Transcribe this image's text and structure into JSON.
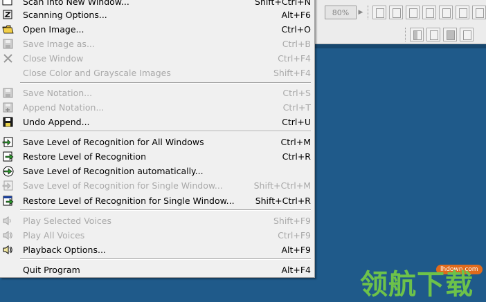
{
  "toolbar": {
    "zoom_value": "80%"
  },
  "menu": {
    "items": [
      {
        "label": "Scan Into New Window...",
        "shortcut": "Shift+Ctrl+N",
        "enabled": true,
        "icon": "scan-new-window-icon"
      },
      {
        "label": "Scanning Options...",
        "shortcut": "Alt+F6",
        "enabled": true,
        "icon": "scanning-options-icon"
      },
      {
        "label": "Open Image...",
        "shortcut": "Ctrl+O",
        "enabled": true,
        "icon": "open-folder-icon"
      },
      {
        "label": "Save Image as...",
        "shortcut": "Ctrl+B",
        "enabled": false,
        "icon": "save-disk-icon"
      },
      {
        "label": "Close Window",
        "shortcut": "Ctrl+F4",
        "enabled": false,
        "icon": "close-x-icon"
      },
      {
        "label": "Close Color and Grayscale Images",
        "shortcut": "Shift+F4",
        "enabled": false,
        "icon": ""
      },
      {
        "label": "Save Notation...",
        "shortcut": "Ctrl+S",
        "enabled": false,
        "icon": "save-notation-icon"
      },
      {
        "label": "Append Notation...",
        "shortcut": "Ctrl+T",
        "enabled": false,
        "icon": "append-notation-icon"
      },
      {
        "label": "Undo Append...",
        "shortcut": "Ctrl+U",
        "enabled": true,
        "icon": "undo-append-icon"
      },
      {
        "label": "Save Level of Recognition for All Windows",
        "shortcut": "Ctrl+M",
        "enabled": true,
        "icon": "save-level-all-icon"
      },
      {
        "label": "Restore Level of Recognition",
        "shortcut": "Ctrl+R",
        "enabled": true,
        "icon": "restore-level-icon"
      },
      {
        "label": "Save Level of Recognition automatically...",
        "shortcut": "",
        "enabled": true,
        "icon": "save-level-auto-icon"
      },
      {
        "label": "Save Level of Recognition for Single Window...",
        "shortcut": "Shift+Ctrl+M",
        "enabled": false,
        "icon": "save-level-single-icon"
      },
      {
        "label": "Restore Level of Recognition for Single Window...",
        "shortcut": "Shift+Ctrl+R",
        "enabled": true,
        "icon": "restore-level-single-icon"
      },
      {
        "label": "Play Selected Voices",
        "shortcut": "Shift+F9",
        "enabled": false,
        "icon": "speaker-icon"
      },
      {
        "label": "Play All Voices",
        "shortcut": "Ctrl+F9",
        "enabled": false,
        "icon": "speaker-all-icon"
      },
      {
        "label": "Playback Options...",
        "shortcut": "Alt+F9",
        "enabled": true,
        "icon": "playback-options-icon"
      },
      {
        "label": "Quit Program",
        "shortcut": "Alt+F4",
        "enabled": true,
        "icon": ""
      }
    ]
  },
  "watermark": {
    "badge": "lhdown.com",
    "text": "领航下载"
  },
  "colors": {
    "desktop": "#1f5a8a",
    "menu_bg": "#f0f0f0",
    "disabled_text": "#a9a9a9",
    "watermark_green": "#6dc24a",
    "watermark_badge": "#e06a1b"
  }
}
